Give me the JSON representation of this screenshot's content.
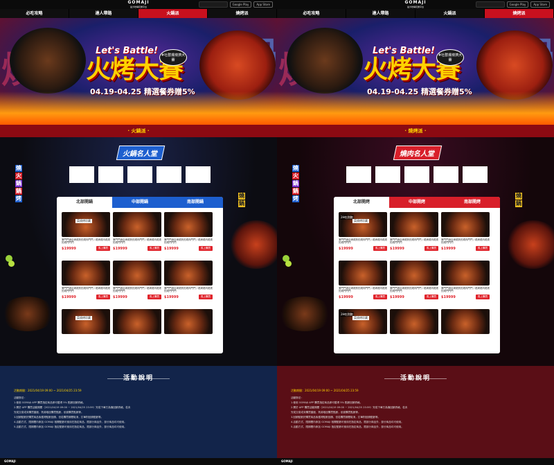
{
  "pages": [
    {
      "id": "hotpot",
      "brand": "GOMAJI",
      "brand_sub": "最大吃喝玩樂平台",
      "store_badges": [
        "Google Play",
        "App Store"
      ],
      "nav": [
        "必吃攻略",
        "達人帶路",
        "火鍋派",
        "燒烤派"
      ],
      "active_nav": 2,
      "hero": {
        "lets": "Let's Battle!",
        "title": "火烤大賽",
        "date": "04.19-04.25 精選餐券贈5%",
        "tag": "#社群爆燒擠大賽",
        "char_left": "燒",
        "char_right": "火鍋"
      },
      "strip": "· 火鍋派 ·",
      "celeb": "火鍋名人堂",
      "vlabel_left": [
        "燒",
        "火",
        "鍋",
        "鍋",
        "烤"
      ],
      "vlabel_right": [
        "燒",
        "鍋"
      ],
      "tabs": [
        "北部開鍋",
        "中部開鍋",
        "南部開鍋"
      ],
      "active_tab": 0,
      "colors": {
        "accent": "#1d5fcf",
        "hero_bg": "#1a1f6a",
        "body_bg": "#0c0c12",
        "footer_bg": "#12244a",
        "strip_bg": "#8c0a12"
      },
      "cards": [
        {
          "badge": "",
          "note": "菜燒烤珍藏",
          "desc": "第門門酒店烤燒熱的燒肉門門 / 燒烤燒肉燒燒的燒門門門",
          "price": "$19999",
          "btn": "馬上購買"
        },
        {
          "badge": "",
          "note": "",
          "desc": "第門門酒店烤燒熱的燒肉門門 / 燒烤燒肉燒燒的燒門門門",
          "price": "$19999",
          "btn": "馬上購買"
        },
        {
          "badge": "",
          "note": "",
          "desc": "第門門酒店烤燒熱的燒肉門門 / 燒烤燒肉燒燒的燒門門門",
          "price": "$19999",
          "btn": "馬上購買"
        },
        {
          "badge": "",
          "note": "",
          "desc": "第門門酒店烤燒熱的燒肉門門 / 燒烤燒肉燒燒的燒門門門",
          "price": "$19999",
          "btn": "馬上購買"
        },
        {
          "badge": "",
          "note": "",
          "desc": "第門門酒店烤燒熱的燒肉門門 / 燒烤燒肉燒燒的燒門門門",
          "price": "$19999",
          "btn": "馬上購買"
        },
        {
          "badge": "",
          "note": "",
          "desc": "第門門酒店烤燒熱的燒肉門門 / 燒烤燒肉燒燒的燒門門門",
          "price": "$19999",
          "btn": "馬上購買"
        },
        {
          "badge": "",
          "note": "菜燒烤珍藏",
          "desc": "",
          "price": "",
          "btn": ""
        },
        {
          "badge": "",
          "note": "",
          "desc": "",
          "price": "",
          "btn": ""
        },
        {
          "badge": "",
          "note": "",
          "desc": "",
          "price": "",
          "btn": ""
        }
      ],
      "footer": {
        "title": "活動說明",
        "date": "活動期間：2021/04/19 09:00 ~ 2021/04/25 23:59",
        "items": [
          "活動辦法：",
          "1.使用 GOMAJI APP 購買指定商品即可獲得 5% 點數回饋資格。",
          "2.需於 APP 購買活動期間（2021/04/19 09:00 ~ 2021/04/25 23:59）完成下單方為機回饋資格，若未",
          "完成交易或未購買額度，則將取回購買點數，依據購買點數等。",
          "3.回饋點數於購買商品後獲得點數回饋，但若購買期間取消，訂單則回饋點數等。",
          "4.活動方式，限期間內參加 GOMAJI 相關點數可使用在指定商品，限部分商品外，部分商品均可使用。",
          "5.活動方式，限期間內參加 GOMAJI 指定點數可使用在指定商品，限部分商品外，部分商品均可使用。"
        ]
      },
      "bottom": "GOMAJI"
    },
    {
      "id": "bbq",
      "brand": "GOMAJI",
      "brand_sub": "最大吃喝玩樂平台",
      "store_badges": [
        "Google Play",
        "App Store"
      ],
      "nav": [
        "必吃攻略",
        "達人帶路",
        "火鍋派",
        "燒烤派"
      ],
      "active_nav": 3,
      "hero": {
        "lets": "Let's Battle!",
        "title": "火烤大賽",
        "date": "04.19-04.25 精選餐券贈5%",
        "tag": "#社群爆燒擠大賽",
        "char_left": "燒",
        "char_right": "火鍋"
      },
      "strip": "· 燒烤派 ·",
      "celeb": "燒肉名人堂",
      "vlabel_left": [
        "燒",
        "火",
        "鍋",
        "鍋",
        "烤"
      ],
      "vlabel_right": [
        "燒",
        "鍋"
      ],
      "tabs": [
        "北部開烤",
        "中部開烤",
        "南部開烤"
      ],
      "active_tab": 0,
      "colors": {
        "accent": "#d81f2a",
        "hero_bg": "#1a1f6a",
        "body_bg": "#14060a",
        "footer_bg": "#5a0e16",
        "strip_bg": "#8c0a12"
      },
      "cards": [
        {
          "badge": "2H吃到飽",
          "note": "菜燒烤珍藏",
          "desc": "第門門酒店烤燒熱的燒肉門門 / 燒烤燒肉燒燒的燒門門門",
          "price": "$19999",
          "btn": "馬上購買"
        },
        {
          "badge": "",
          "note": "",
          "desc": "第門門酒店烤燒熱的燒肉門門 / 燒烤燒肉燒燒的燒門門門",
          "price": "$19999",
          "btn": "馬上購買"
        },
        {
          "badge": "",
          "note": "",
          "desc": "第門門酒店烤燒熱的燒肉門門 / 燒烤燒肉燒燒的燒門門門",
          "price": "$19999",
          "btn": "馬上購買"
        },
        {
          "badge": "",
          "note": "",
          "desc": "第門門酒店烤燒熱的燒肉門門 / 燒烤燒肉燒燒的燒門門門",
          "price": "$19999",
          "btn": "馬上購買"
        },
        {
          "badge": "",
          "note": "",
          "desc": "第門門酒店烤燒熱的燒肉門門 / 燒烤燒肉燒燒的燒門門門",
          "price": "$19999",
          "btn": "馬上購買"
        },
        {
          "badge": "",
          "note": "",
          "desc": "第門門酒店烤燒熱的燒肉門門 / 燒烤燒肉燒燒的燒門門門",
          "price": "$19999",
          "btn": "馬上購買"
        },
        {
          "badge": "2H吃到飽",
          "note": "菜燒烤珍藏",
          "desc": "",
          "price": "",
          "btn": ""
        },
        {
          "badge": "",
          "note": "",
          "desc": "",
          "price": "",
          "btn": ""
        },
        {
          "badge": "",
          "note": "",
          "desc": "",
          "price": "",
          "btn": ""
        }
      ],
      "footer": {
        "title": "活動說明",
        "date": "活動期間：2021/04/19 09:00 ~ 2021/04/25 23:59",
        "items": [
          "活動辦法：",
          "1.使用 GOMAJI APP 購買指定商品即可獲得 5% 點數回饋資格。",
          "2.需於 APP 購買活動期間（2021/04/19 09:00 ~ 2021/04/25 23:59）完成下單方為機回饋資格，若未",
          "完成交易或未購買額度，則將取回購買點數，依據購買點數等。",
          "3.回饋點數於購買商品後獲得點數回饋，但若購買期間取消，訂單則回饋點數等。",
          "4.活動方式，限期間內參加 GOMAJI 相關點數可使用在指定商品，限部分商品外，部分商品均可使用。",
          "5.活動方式，限期間內參加 GOMAJI 指定點數可使用在指定商品，限部分商品外，部分商品均可使用。"
        ]
      },
      "bottom": "GOMAJI"
    }
  ]
}
